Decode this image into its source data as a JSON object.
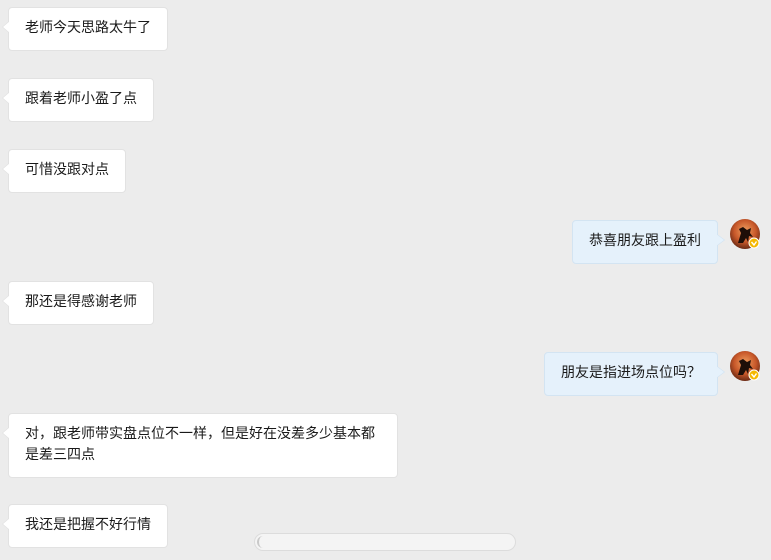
{
  "messages": [
    {
      "direction": "in",
      "text": "老师今天思路太牛了"
    },
    {
      "direction": "in",
      "text": "跟着老师小盈了点"
    },
    {
      "direction": "in",
      "text": "可惜没跟对点"
    },
    {
      "direction": "out",
      "text": "恭喜朋友跟上盈利",
      "avatar": "horse-avatar-icon"
    },
    {
      "direction": "in",
      "text": "那还是得感谢老师"
    },
    {
      "direction": "out",
      "text": "朋友是指进场点位吗？",
      "avatar": "horse-avatar-icon"
    },
    {
      "direction": "in",
      "text": "对，跟老师带实盘点位不一样，但是好在没差多少基本都\n是差三四点"
    },
    {
      "direction": "in",
      "text": "我还是把握不好行情"
    }
  ],
  "colors": {
    "background": "#ececec",
    "incoming_bubble": "#ffffff",
    "outgoing_bubble": "#e5f1fb",
    "avatar_badge": "#f5b800"
  }
}
